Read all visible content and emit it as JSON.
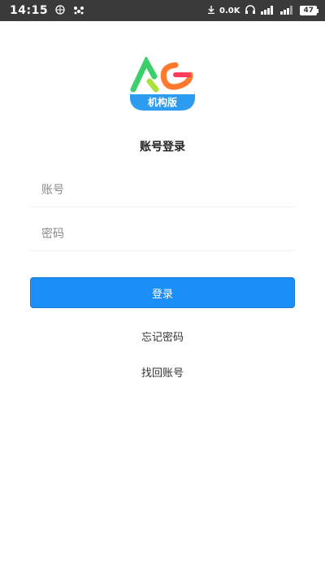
{
  "status_bar": {
    "time": "14:15",
    "net_speed": "0.0K",
    "battery": "47"
  },
  "logo": {
    "label": "机构版",
    "colors": {
      "base": "#2d9cf0",
      "green": "#3bd06a",
      "orange": "#ff7a2e",
      "red": "#ff3b5c"
    }
  },
  "page": {
    "title": "账号登录"
  },
  "form": {
    "account_placeholder": "账号",
    "password_placeholder": "密码",
    "login_label": "登录",
    "forgot_password": "忘记密码",
    "recover_account": "找回账号"
  },
  "colors": {
    "accent": "#1b8ef8",
    "status_bar": "#3a3a3a"
  }
}
